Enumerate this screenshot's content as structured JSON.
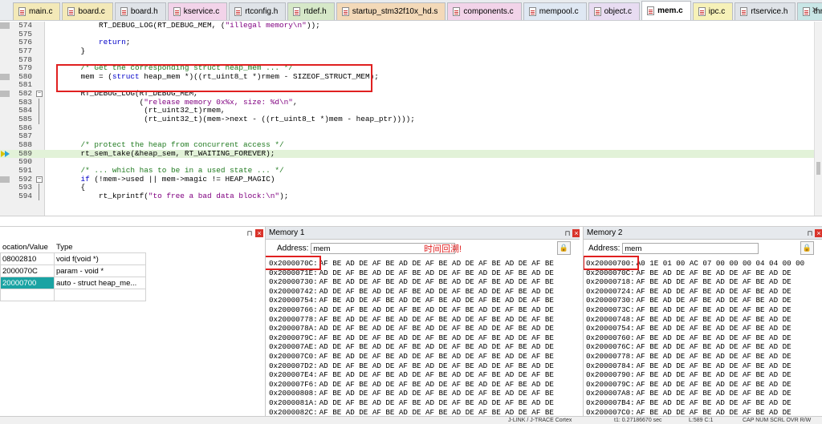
{
  "tabs": [
    {
      "label": "main.c",
      "color": "#f3e9b8",
      "active": false
    },
    {
      "label": "board.c",
      "color": "#f3e9b8",
      "active": false
    },
    {
      "label": "board.h",
      "color": "#dfe3e8",
      "active": false
    },
    {
      "label": "kservice.c",
      "color": "#f2d3e9",
      "active": false
    },
    {
      "label": "rtconfig.h",
      "color": "#dfe3e8",
      "active": false
    },
    {
      "label": "rtdef.h",
      "color": "#d6e8c8",
      "active": false
    },
    {
      "label": "startup_stm32f10x_hd.s",
      "color": "#f3d9b8",
      "active": false
    },
    {
      "label": "components.c",
      "color": "#f2d3e9",
      "active": false
    },
    {
      "label": "mempool.c",
      "color": "#dfe8f3",
      "active": false
    },
    {
      "label": "object.c",
      "color": "#e8dcf2",
      "active": false
    },
    {
      "label": "mem.c",
      "color": "#ffffff",
      "active": true
    },
    {
      "label": "ipc.c",
      "color": "#f6f1b8",
      "active": false
    },
    {
      "label": "rtservice.h",
      "color": "#dfe3e8",
      "active": false
    },
    {
      "label": "thread.c",
      "color": "#c8e6e6",
      "active": false
    }
  ],
  "tab_corner_icon": "close-icon",
  "editor": {
    "lines": [
      {
        "n": "574",
        "code": "        RT_DEBUG_LOG(RT_DEBUG_MEM, (\"illegal memory\\n\"));",
        "type": "normal",
        "marker": true
      },
      {
        "n": "575",
        "code": "",
        "type": "normal"
      },
      {
        "n": "576",
        "code": "        return;",
        "type": "normal"
      },
      {
        "n": "577",
        "code": "    }",
        "type": "normal"
      },
      {
        "n": "578",
        "code": "",
        "type": "normal"
      },
      {
        "n": "579",
        "code": "    /* Get the corresponding struct heap_mem ... */",
        "type": "comment"
      },
      {
        "n": "580",
        "code": "    mem = (struct heap_mem *)((rt_uint8_t *)rmem - SIZEOF_STRUCT_MEM);",
        "type": "normal",
        "marker": true
      },
      {
        "n": "581",
        "code": "",
        "type": "normal"
      },
      {
        "n": "582",
        "code": "    RT_DEBUG_LOG(RT_DEBUG_MEM,",
        "type": "normal",
        "marker": true,
        "fold": true
      },
      {
        "n": "583",
        "code": "                 (\"release memory 0x%x, size: %d\\n\",",
        "type": "normal"
      },
      {
        "n": "584",
        "code": "                  (rt_uint32_t)rmem,",
        "type": "normal"
      },
      {
        "n": "585",
        "code": "                  (rt_uint32_t)(mem->next - ((rt_uint8_t *)mem - heap_ptr))));",
        "type": "normal"
      },
      {
        "n": "586",
        "code": "",
        "type": "normal"
      },
      {
        "n": "587",
        "code": "",
        "type": "normal"
      },
      {
        "n": "588",
        "code": "    /* protect the heap from concurrent access */",
        "type": "comment"
      },
      {
        "n": "589",
        "code": "    rt_sem_take(&heap_sem, RT_WAITING_FOREVER);",
        "type": "current"
      },
      {
        "n": "590",
        "code": "",
        "type": "normal"
      },
      {
        "n": "591",
        "code": "    /* ... which has to be in a used state ... */",
        "type": "comment"
      },
      {
        "n": "592",
        "code": "    if (!mem->used || mem->magic != HEAP_MAGIC)",
        "type": "normal",
        "marker": true,
        "fold": true
      },
      {
        "n": "593",
        "code": "    {",
        "type": "normal"
      },
      {
        "n": "594",
        "code": "        rt_kprintf(\"to free a bad data block:\\n\");",
        "type": "normal"
      }
    ]
  },
  "watch": {
    "title": "",
    "col_location": "ocation/Value",
    "col_type": "Type",
    "rows": [
      {
        "value": "08002810",
        "type": "void f(void *)",
        "selected": false
      },
      {
        "value": "2000070C",
        "type": "param - void *",
        "selected": false
      },
      {
        "value": "20000700",
        "type": "auto - struct heap_me...",
        "selected": true
      },
      {
        "value": "",
        "type": "",
        "selected": false
      }
    ]
  },
  "memory1": {
    "title": "Memory 1",
    "address_label": "Address:",
    "address_value": "mem",
    "annotation": "时间回溯!",
    "rows": [
      {
        "addr": "0x2000070C:",
        "bytes": "AF BE AD DE AF BE AD DE AF BE AD DE AF BE AD DE AF BE"
      },
      {
        "addr": "0x2000071E:",
        "bytes": "AD DE AF BE AD DE AF BE AD DE AF BE AD DE AF BE AD DE"
      },
      {
        "addr": "0x20000730:",
        "bytes": "AF BE AD DE AF BE AD DE AF BE AD DE AF BE AD DE AF BE"
      },
      {
        "addr": "0x20000742:",
        "bytes": "AD DE AF BE AD DE AF BE AD DE AF BE AD DE AF BE AD DE"
      },
      {
        "addr": "0x20000754:",
        "bytes": "AF BE AD DE AF BE AD DE AF BE AD DE AF BE AD DE AF BE"
      },
      {
        "addr": "0x20000766:",
        "bytes": "AD DE AF BE AD DE AF BE AD DE AF BE AD DE AF BE AD DE"
      },
      {
        "addr": "0x20000778:",
        "bytes": "AF BE AD DE AF BE AD DE AF BE AD DE AF BE AD DE AF BE"
      },
      {
        "addr": "0x2000078A:",
        "bytes": "AD DE AF BE AD DE AF BE AD DE AF BE AD DE AF BE AD DE"
      },
      {
        "addr": "0x2000079C:",
        "bytes": "AF BE AD DE AF BE AD DE AF BE AD DE AF BE AD DE AF BE"
      },
      {
        "addr": "0x200007AE:",
        "bytes": "AD DE AF BE AD DE AF BE AD DE AF BE AD DE AF BE AD DE"
      },
      {
        "addr": "0x200007C0:",
        "bytes": "AF BE AD DE AF BE AD DE AF BE AD DE AF BE AD DE AF BE"
      },
      {
        "addr": "0x200007D2:",
        "bytes": "AD DE AF BE AD DE AF BE AD DE AF BE AD DE AF BE AD DE"
      },
      {
        "addr": "0x200007E4:",
        "bytes": "AF BE AD DE AF BE AD DE AF BE AD DE AF BE AD DE AF BE"
      },
      {
        "addr": "0x200007F6:",
        "bytes": "AD DE AF BE AD DE AF BE AD DE AF BE AD DE AF BE AD DE"
      },
      {
        "addr": "0x20000808:",
        "bytes": "AF BE AD DE AF BE AD DE AF BE AD DE AF BE AD DE AF BE"
      },
      {
        "addr": "0x2000081A:",
        "bytes": "AD DE AF BE AD DE AF BE AD DE AF BE AD DE AF BE AD DE"
      },
      {
        "addr": "0x2000082C:",
        "bytes": "AF BE AD DE AF BE AD DE AF BE AD DE AF BE AD DE AF BE"
      }
    ]
  },
  "memory2": {
    "title": "Memory 2",
    "address_label": "Address:",
    "address_value": "mem",
    "rows": [
      {
        "addr": "0x20000700:",
        "bytes": "A0 1E 01 00 AC 07 00 00 00 04 04 00 00"
      },
      {
        "addr": "0x2000070C:",
        "bytes": "AF BE AD DE AF BE AD DE AF BE AD DE"
      },
      {
        "addr": "0x20000718:",
        "bytes": "AF BE AD DE AF BE AD DE AF BE AD DE"
      },
      {
        "addr": "0x20000724:",
        "bytes": "AF BE AD DE AF BE AD DE AF BE AD DE"
      },
      {
        "addr": "0x20000730:",
        "bytes": "AF BE AD DE AF BE AD DE AF BE AD DE"
      },
      {
        "addr": "0x2000073C:",
        "bytes": "AF BE AD DE AF BE AD DE AF BE AD DE"
      },
      {
        "addr": "0x20000748:",
        "bytes": "AF BE AD DE AF BE AD DE AF BE AD DE"
      },
      {
        "addr": "0x20000754:",
        "bytes": "AF BE AD DE AF BE AD DE AF BE AD DE"
      },
      {
        "addr": "0x20000760:",
        "bytes": "AF BE AD DE AF BE AD DE AF BE AD DE"
      },
      {
        "addr": "0x2000076C:",
        "bytes": "AF BE AD DE AF BE AD DE AF BE AD DE"
      },
      {
        "addr": "0x20000778:",
        "bytes": "AF BE AD DE AF BE AD DE AF BE AD DE"
      },
      {
        "addr": "0x20000784:",
        "bytes": "AF BE AD DE AF BE AD DE AF BE AD DE"
      },
      {
        "addr": "0x20000790:",
        "bytes": "AF BE AD DE AF BE AD DE AF BE AD DE"
      },
      {
        "addr": "0x2000079C:",
        "bytes": "AF BE AD DE AF BE AD DE AF BE AD DE"
      },
      {
        "addr": "0x200007A8:",
        "bytes": "AF BE AD DE AF BE AD DE AF BE AD DE"
      },
      {
        "addr": "0x200007B4:",
        "bytes": "AF BE AD DE AF BE AD DE AF BE AD DE"
      },
      {
        "addr": "0x200007C0:",
        "bytes": "AF BE AD DE AF BE AD DE AF BE AD DE"
      }
    ]
  },
  "statusbar": {
    "debugger": "J-LINK / J-TRACE Cortex",
    "time": "t1: 0.27186670 sec",
    "position": "L:589 C:1",
    "flags": "CAP NUM SCRL OVR R/W"
  }
}
